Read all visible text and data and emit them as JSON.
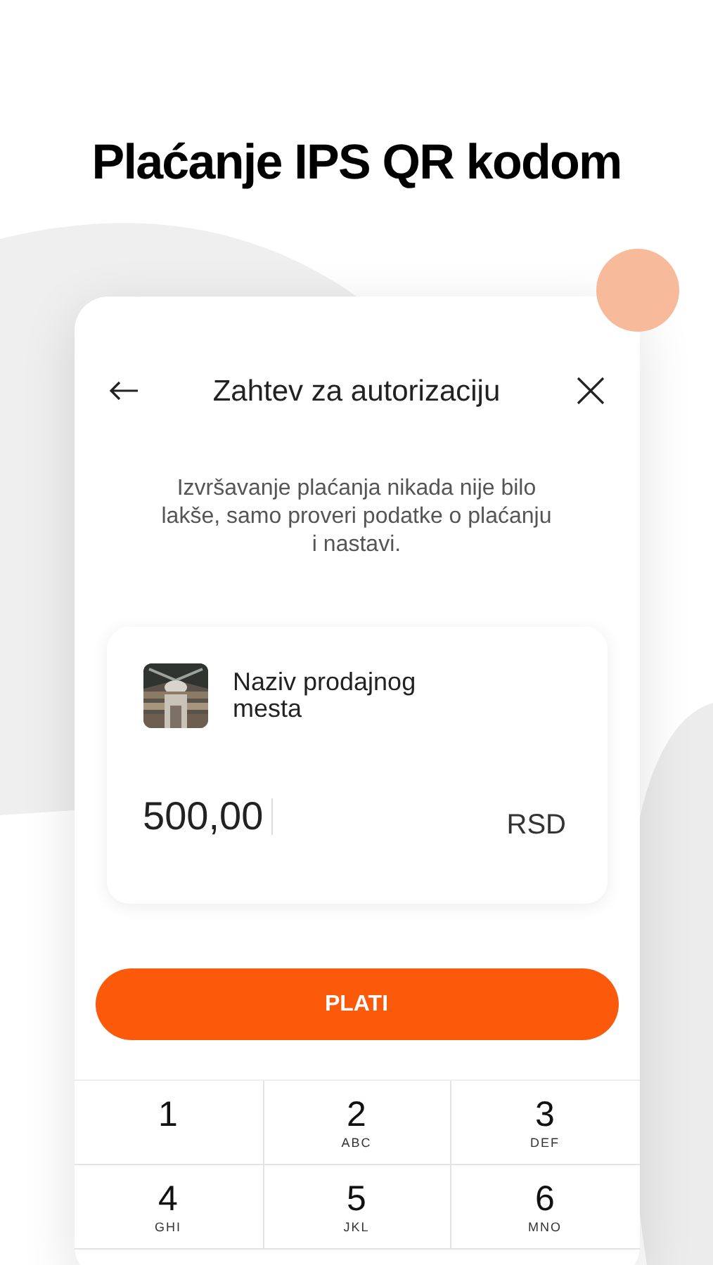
{
  "headline": "Plaćanje IPS QR kodom",
  "screen": {
    "title": "Zahtev za autorizaciju",
    "intro": "Izvršavanje plaćanja nikada nije bilo lakše, samo proveri podatke o plaćanju i nastavi.",
    "merchant": {
      "name": "Naziv prodajnog mesta"
    },
    "amount": {
      "value": "500,00",
      "currency": "RSD"
    },
    "pay_button": "PLATI",
    "keypad": [
      {
        "digit": "1"
      },
      {
        "digit": "2",
        "letters": "ABC"
      },
      {
        "digit": "3",
        "letters": "DEF"
      },
      {
        "digit": "4",
        "letters": "GHI"
      },
      {
        "digit": "5",
        "letters": "JKL"
      },
      {
        "digit": "6",
        "letters": "MNO"
      }
    ]
  }
}
